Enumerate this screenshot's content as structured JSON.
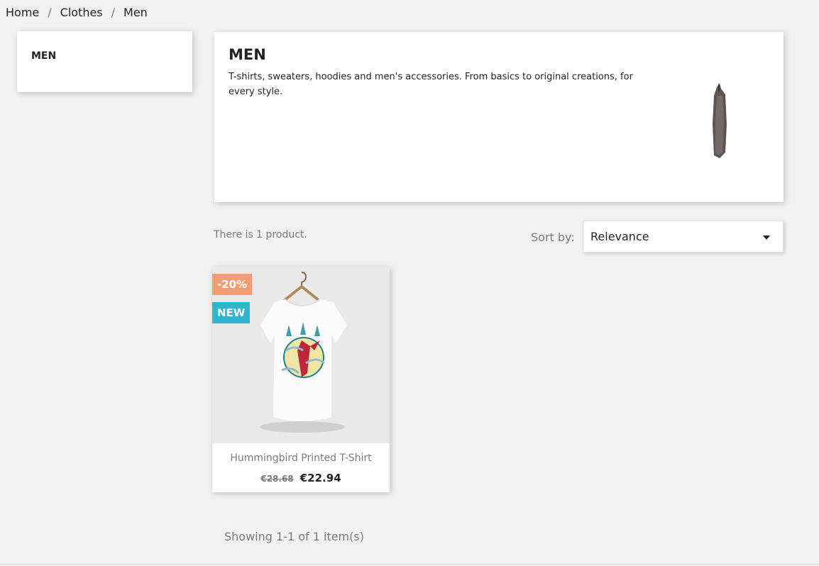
{
  "breadcrumb": {
    "items": [
      "Home",
      "Clothes",
      "Men"
    ],
    "separator": "/"
  },
  "sidebar": {
    "title": "MEN"
  },
  "category": {
    "title": "MEN",
    "description": "T-shirts, sweaters, hoodies and men's accessories. From basics to original creations, for every style."
  },
  "listing": {
    "count_text": "There is 1 product.",
    "sort_label": "Sort by:",
    "sort_value": "Relevance",
    "pagination_text": "Showing 1-1 of 1 item(s)"
  },
  "products": [
    {
      "name": "Hummingbird Printed T-Shirt",
      "regular_price": "€28.68",
      "price": "€22.94",
      "badges": {
        "discount": "-20%",
        "new": "NEW"
      }
    }
  ],
  "colors": {
    "discount_badge": "#f39d72",
    "new_badge": "#2fb5d2",
    "background": "#f1f1f1"
  }
}
